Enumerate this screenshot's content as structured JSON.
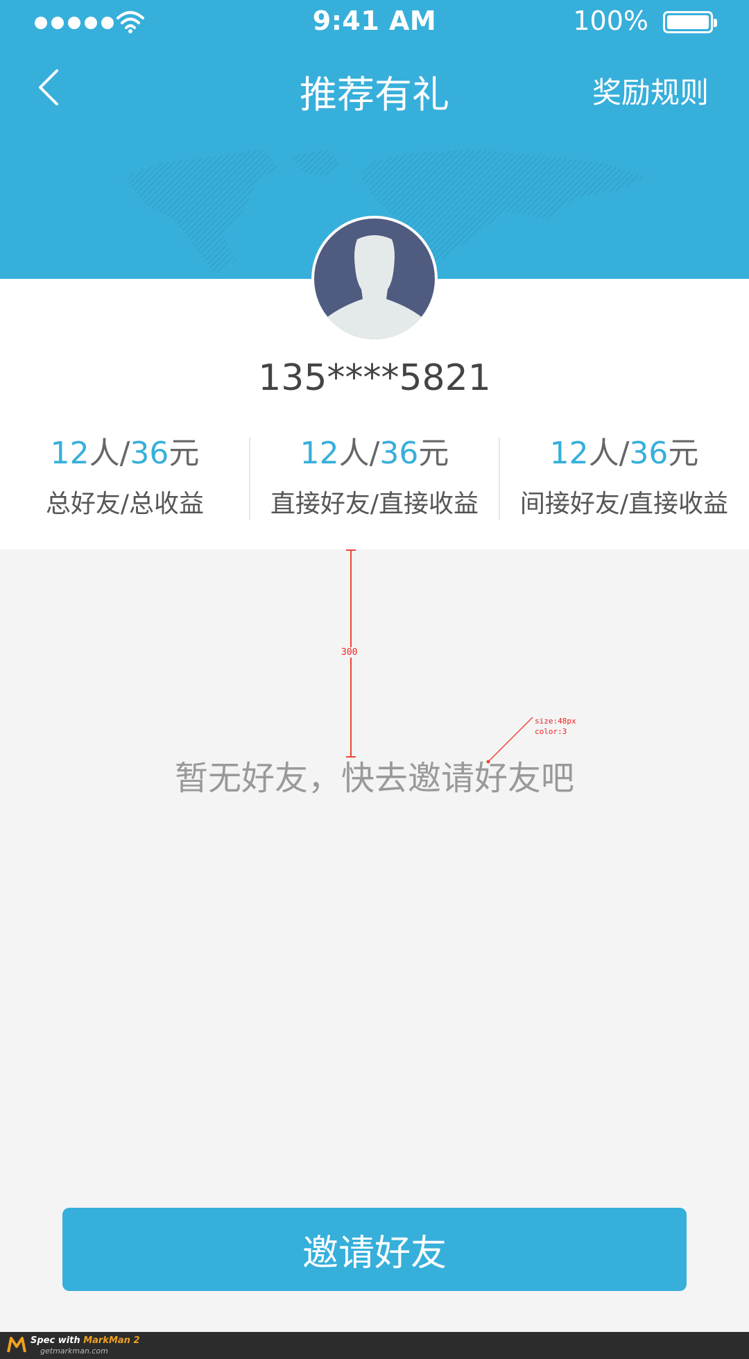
{
  "status_bar": {
    "time": "9:41 AM",
    "battery": "100%"
  },
  "nav": {
    "title": "推荐有礼",
    "rules": "奖励规则"
  },
  "user": {
    "phone": "135****5821"
  },
  "stats": [
    {
      "count": "12",
      "count_unit": "人",
      "sep": "/",
      "amount": "36",
      "amount_unit": "元",
      "label": "总好友/总收益"
    },
    {
      "count": "12",
      "count_unit": "人",
      "sep": "/",
      "amount": "36",
      "amount_unit": "元",
      "label": "直接好友/直接收益"
    },
    {
      "count": "12",
      "count_unit": "人",
      "sep": "/",
      "amount": "36",
      "amount_unit": "元",
      "label": "间接好友/直接收益"
    }
  ],
  "empty_state": {
    "message": "暂无好友，快去邀请好友吧"
  },
  "annotations": {
    "spacing": "300",
    "font_size": "size:48px",
    "color": "color:3"
  },
  "invite_button": {
    "label": "邀请好友"
  },
  "footer": {
    "spec_with": "Spec with ",
    "app": "MarkMan 2",
    "site": "getmarkman.com"
  },
  "colors": {
    "primary": "#37afdb",
    "background": "#f4f4f4",
    "avatar": "#4f5b7f"
  }
}
